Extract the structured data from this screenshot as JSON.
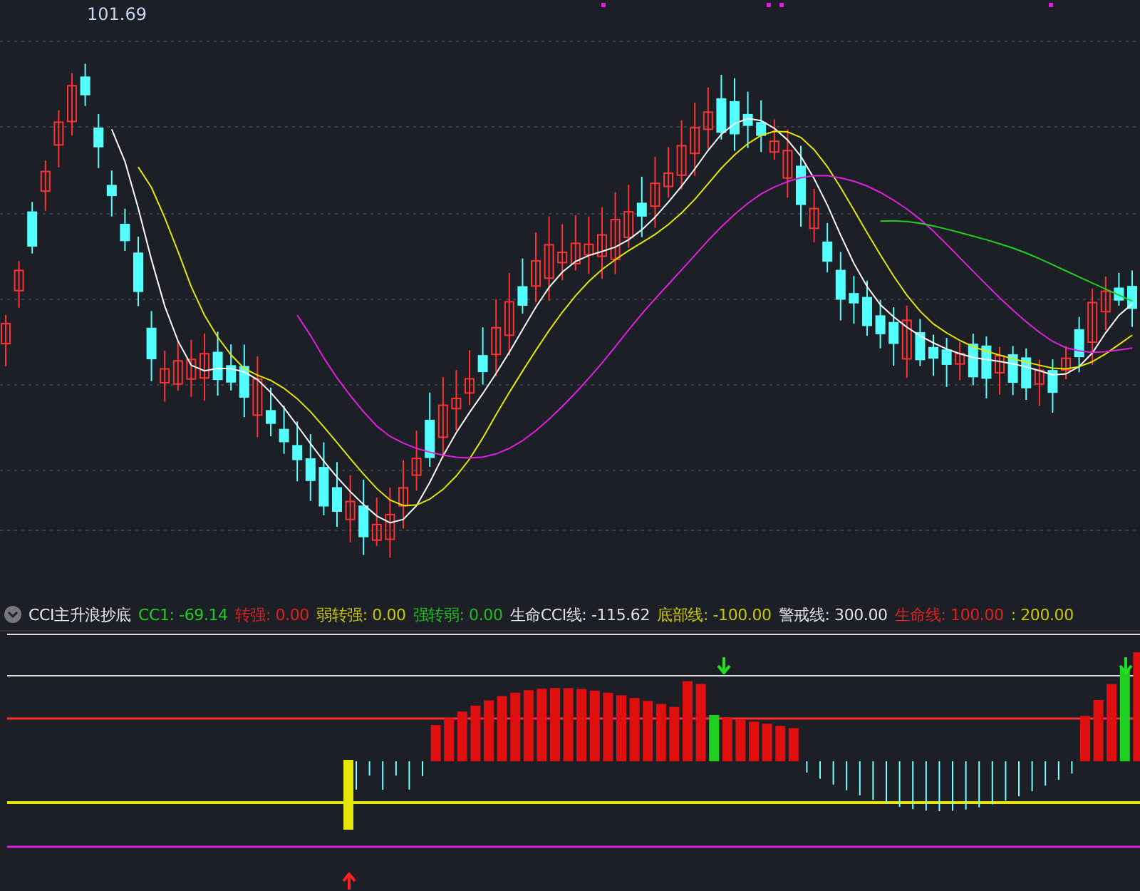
{
  "price_chart": {
    "high_label": "101.69"
  },
  "indicator": {
    "name": "CCI主升浪抄底",
    "values": [
      {
        "text": "CC1: -69.14",
        "color": "#22cc22"
      },
      {
        "text": "转强: 0.00",
        "color": "#e02020"
      },
      {
        "text": "弱转强: 0.00",
        "color": "#c8c800"
      },
      {
        "text": "强转弱: 0.00",
        "color": "#22bb22"
      },
      {
        "text": "生命CCI线: -115.62",
        "color": "#e0e0e0"
      },
      {
        "text": "底部线: -100.00",
        "color": "#c8c800"
      },
      {
        "text": "警戒线: 300.00",
        "color": "#e0e0e0"
      },
      {
        "text": "生命线: 100.00",
        "color": "#e02020"
      },
      {
        "text": ": 200.00",
        "color": "#c8c800"
      }
    ]
  }
}
